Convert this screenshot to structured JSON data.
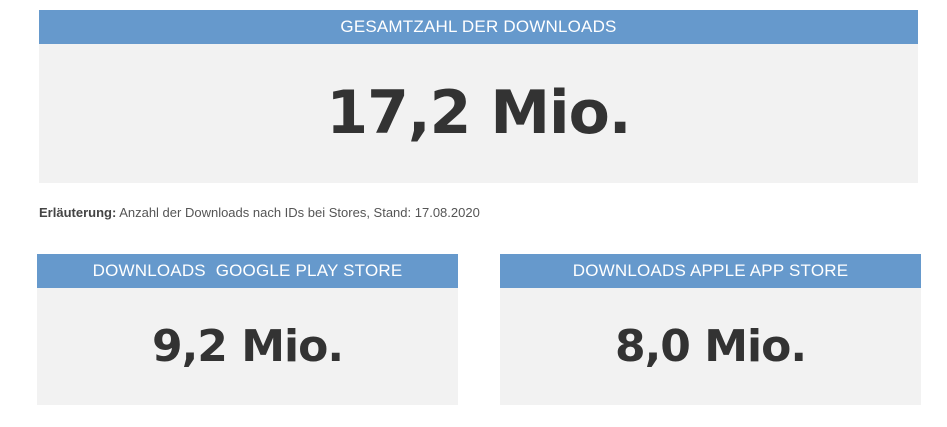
{
  "total": {
    "header": "GESAMTZAHL DER DOWNLOADS",
    "value": "17,2 Mio."
  },
  "note": {
    "label": "Erläuterung:",
    "text": " Anzahl der Downloads nach IDs bei Stores, Stand: 17.08.2020"
  },
  "google": {
    "header": "DOWNLOADS  GOOGLE PLAY STORE",
    "value": "9,2 Mio."
  },
  "apple": {
    "header": "DOWNLOADS APPLE APP STORE",
    "value": "8,0 Mio."
  },
  "colors": {
    "header_bg": "#6699cc",
    "card_bg": "#f2f2f2",
    "value_text": "#333333"
  }
}
